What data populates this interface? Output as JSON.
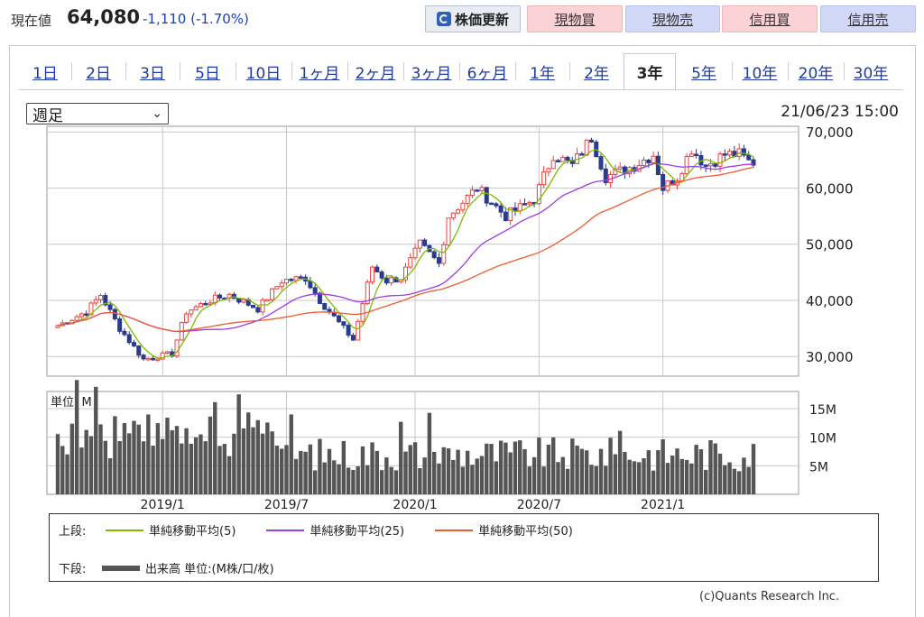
{
  "header": {
    "price_label": "現在値",
    "price_value": "64,080",
    "price_change": "-1,110 (-1.70%)",
    "refresh_label": "株価更新",
    "buttons": [
      "現物買",
      "現物売",
      "信用買",
      "信用売"
    ],
    "colors": {
      "pink": "#fbd2d6",
      "blue": "#d2d8f7",
      "change": "#1a3fbf"
    }
  },
  "tabs": {
    "items": [
      "1日",
      "2日",
      "3日",
      "5日",
      "10日",
      "1ヶ月",
      "2ヶ月",
      "3ヶ月",
      "6ヶ月",
      "1年",
      "2年",
      "3年",
      "5年",
      "10年",
      "20年",
      "30年"
    ],
    "active": "3年"
  },
  "controls": {
    "period_select": "週足",
    "timestamp": "21/06/23 15:00"
  },
  "chart_data": {
    "type": "candlestick",
    "x_ticks": [
      "2019/1",
      "2019/7",
      "2020/1",
      "2020/7",
      "2021/1"
    ],
    "price_axis": {
      "ticks": [
        "30,000",
        "40,000",
        "50,000",
        "60,000",
        "70,000"
      ],
      "range": [
        26500,
        71000
      ]
    },
    "volume_axis": {
      "unit_label": "単位: M",
      "ticks": [
        "5M",
        "10M",
        "15M"
      ],
      "range": [
        0,
        18
      ]
    },
    "price_anchor_weeks": [
      0,
      6,
      9,
      13,
      18,
      24,
      27,
      32,
      36,
      42,
      47,
      52,
      55,
      62,
      66,
      69,
      72,
      76,
      80,
      82,
      88,
      94,
      100,
      104,
      108,
      112,
      115,
      121,
      125,
      127,
      130,
      133,
      136,
      140,
      143,
      146
    ],
    "price_anchor_values": [
      35500,
      38000,
      41000,
      35000,
      29500,
      30500,
      38000,
      40000,
      41000,
      38500,
      43500,
      44000,
      40000,
      33000,
      46000,
      43500,
      44000,
      50000,
      46500,
      55000,
      60000,
      55000,
      58000,
      66000,
      64000,
      69000,
      62000,
      64000,
      66000,
      60000,
      62000,
      67000,
      64000,
      66000,
      66000,
      64080
    ],
    "ma_color": {
      "ma5": "#7fba00",
      "ma25": "#9f3de0",
      "ma50": "#ef5b2e"
    },
    "up_color": "#f04040",
    "down_color": "#2a3b8f",
    "volume_color": "#555555"
  },
  "legend": {
    "upper_label": "上段:",
    "lower_label": "下段:",
    "ma_labels": [
      "単純移動平均(5)",
      "単純移動平均(25)",
      "単純移動平均(50)"
    ],
    "volume_label": "出来高 単位:(M株/口/枚)"
  },
  "footer": {
    "copyright": "(c)Quants Research Inc."
  }
}
